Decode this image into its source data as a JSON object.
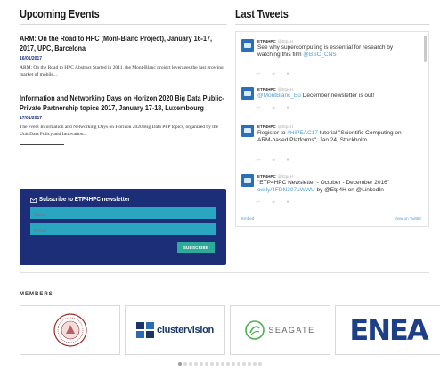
{
  "events": {
    "title": "Upcoming Events",
    "items": [
      {
        "title": "ARM: On the Road to HPC (Mont-Blanc Project), January 16-17, 2017, UPC, Barcelona",
        "date": "16/01/2017",
        "desc": "ARM: On the Road to HPC Abstract Started in 2011, the Mont-Blanc project leverages the fast growing market of mobile..."
      },
      {
        "title": "Information and Networking Days on Horizon 2020 Big Data Public-Private Partnership topics 2017, January 17-18, Luxembourg",
        "date": "17/01/2017",
        "desc": "The event Information and Networking Days on Horizon 2020 Big Data PPP topics, organized by the Unit Data Policy and Innovation..."
      }
    ]
  },
  "newsletter": {
    "title": "Subscribe to ETP4HPC newsletter",
    "name_placeholder": "Name",
    "email_placeholder": "E-Mail",
    "button_label": "SUBSCRIBE"
  },
  "tweets": {
    "title": "Last Tweets",
    "items": [
      {
        "handle": "ETP4HPC",
        "at": "@Etp4H",
        "parts": [
          "See why supercomputing is essential for research by watching this film ",
          "@BSC_CNS",
          ""
        ]
      },
      {
        "handle": "ETP4HPC",
        "at": "@Etp4H",
        "parts": [
          "",
          "@MontBlanc_Eu",
          " December newsletter is out!"
        ]
      },
      {
        "handle": "ETP4HPC",
        "at": "@Etp4H",
        "parts": [
          "Register to ",
          "#HiPEAC17",
          " tutorial \"Scientific Computing on ARM-based Platforms\", Jan 24, Stockholm"
        ]
      },
      {
        "handle": "ETP4HPC",
        "at": "@Etp4H",
        "parts": [
          "\"ETP4HPC Newsletter - October - December 2016\" ",
          "ow.ly/4FDN307uWWU",
          " by @Etp4H on @LinkedIn"
        ]
      }
    ],
    "footer_left": "Embed",
    "footer_right": "View on Twitter"
  },
  "members": {
    "title": "MEMBERS",
    "logos": [
      {
        "name": "university-seal"
      },
      {
        "name": "clustervision",
        "text_a": "cluster",
        "text_b": "vision"
      },
      {
        "name": "seagate",
        "text": "SEAGATE"
      },
      {
        "name": "enea",
        "text": "ENEA"
      }
    ]
  },
  "pagination": {
    "count": 16,
    "active": 0
  },
  "colors": {
    "brand_blue": "#1c2e78",
    "field_teal": "#2ba6c2",
    "button_green": "#2eaa9a",
    "link_blue": "#4b9fd6"
  }
}
